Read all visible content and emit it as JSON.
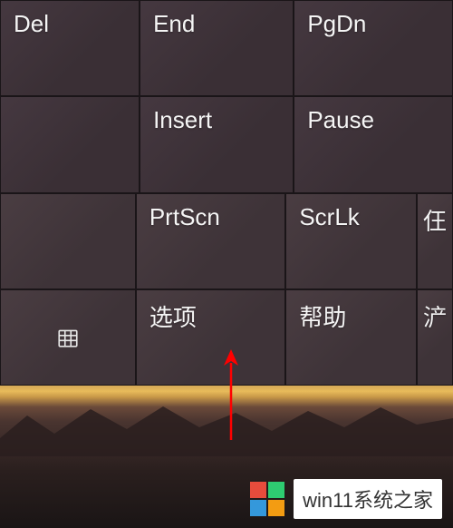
{
  "keyboard": {
    "rows": [
      [
        {
          "label": "Del",
          "name": "del-key"
        },
        {
          "label": "End",
          "name": "end-key"
        },
        {
          "label": "PgDn",
          "name": "pgdn-key"
        }
      ],
      [
        {
          "label": "",
          "name": "empty-key"
        },
        {
          "label": "Insert",
          "name": "insert-key"
        },
        {
          "label": "Pause",
          "name": "pause-key"
        }
      ],
      [
        {
          "label": "",
          "name": "empty-key-2"
        },
        {
          "label": "PrtScn",
          "name": "prtscn-key"
        },
        {
          "label": "ScrLk",
          "name": "scrlk-key"
        },
        {
          "label": "仼",
          "name": "partial-key-1"
        }
      ],
      [
        {
          "label": "",
          "name": "calendar-key",
          "icon": "calendar"
        },
        {
          "label": "选项",
          "name": "options-key"
        },
        {
          "label": "帮助",
          "name": "help-key"
        },
        {
          "label": "浐",
          "name": "partial-key-2"
        }
      ]
    ]
  },
  "annotation": {
    "arrow_color": "#ff0000"
  },
  "watermark": {
    "text": "win11系统之家"
  }
}
